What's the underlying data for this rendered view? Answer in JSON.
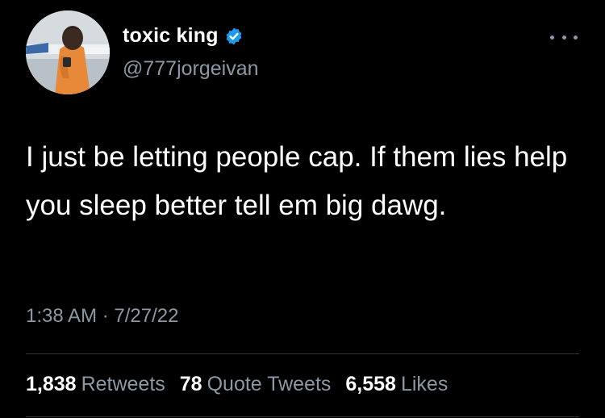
{
  "author": {
    "display_name": "toxic king",
    "handle": "@777jorgeivan",
    "verified_icon": "verified-badge-icon"
  },
  "tweet": {
    "text": "I just be letting people cap. If them lies help you sleep better tell em big dawg.",
    "time": "1:38 AM",
    "separator": "·",
    "date": "7/27/22"
  },
  "stats": {
    "retweets_count": "1,838",
    "retweets_label": "Retweets",
    "quotes_count": "78",
    "quotes_label": "Quote Tweets",
    "likes_count": "6,558",
    "likes_label": "Likes"
  },
  "colors": {
    "background": "#000000",
    "primary_text": "#ffffff",
    "secondary_text": "#8b98a5",
    "verified": "#1d9bf0",
    "divider": "#2f3336"
  }
}
